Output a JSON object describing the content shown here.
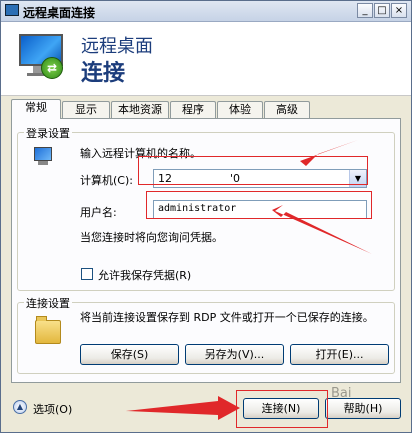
{
  "window": {
    "title": "远程桌面连接",
    "buttons": [
      "_",
      "□",
      "×"
    ]
  },
  "banner": {
    "line1": "远程桌面",
    "line2": "连接",
    "icon": "remote-desktop-icon"
  },
  "tabs": [
    {
      "label": "常规",
      "active": true
    },
    {
      "label": "显示"
    },
    {
      "label": "本地资源"
    },
    {
      "label": "程序"
    },
    {
      "label": "体验"
    },
    {
      "label": "高级"
    }
  ],
  "login": {
    "group_label": "登录设置",
    "prompt": "输入远程计算机的名称。",
    "computer_label": "计算机(C):",
    "computer_value": "12",
    "computer_suffix": "'0",
    "username_label": "用户名:",
    "username_value": "administrator",
    "credential_note": "当您连接时将向您询问凭据。",
    "save_checkbox_label": "允许我保存凭据(R)",
    "save_checked": false
  },
  "connection": {
    "group_label": "连接设置",
    "description": "将当前连接设置保存到 RDP 文件或打开一个已保存的连接。",
    "save_label": "保存(S)",
    "save_as_label": "另存为(V)...",
    "open_label": "打开(E)..."
  },
  "footer": {
    "options_label": "选项(O)",
    "connect_label": "连接(N)",
    "help_label": "帮助(H)"
  },
  "watermark": "Bai",
  "colors": {
    "annotation": "#e0282a",
    "title_blue": "#1c3d7c"
  }
}
